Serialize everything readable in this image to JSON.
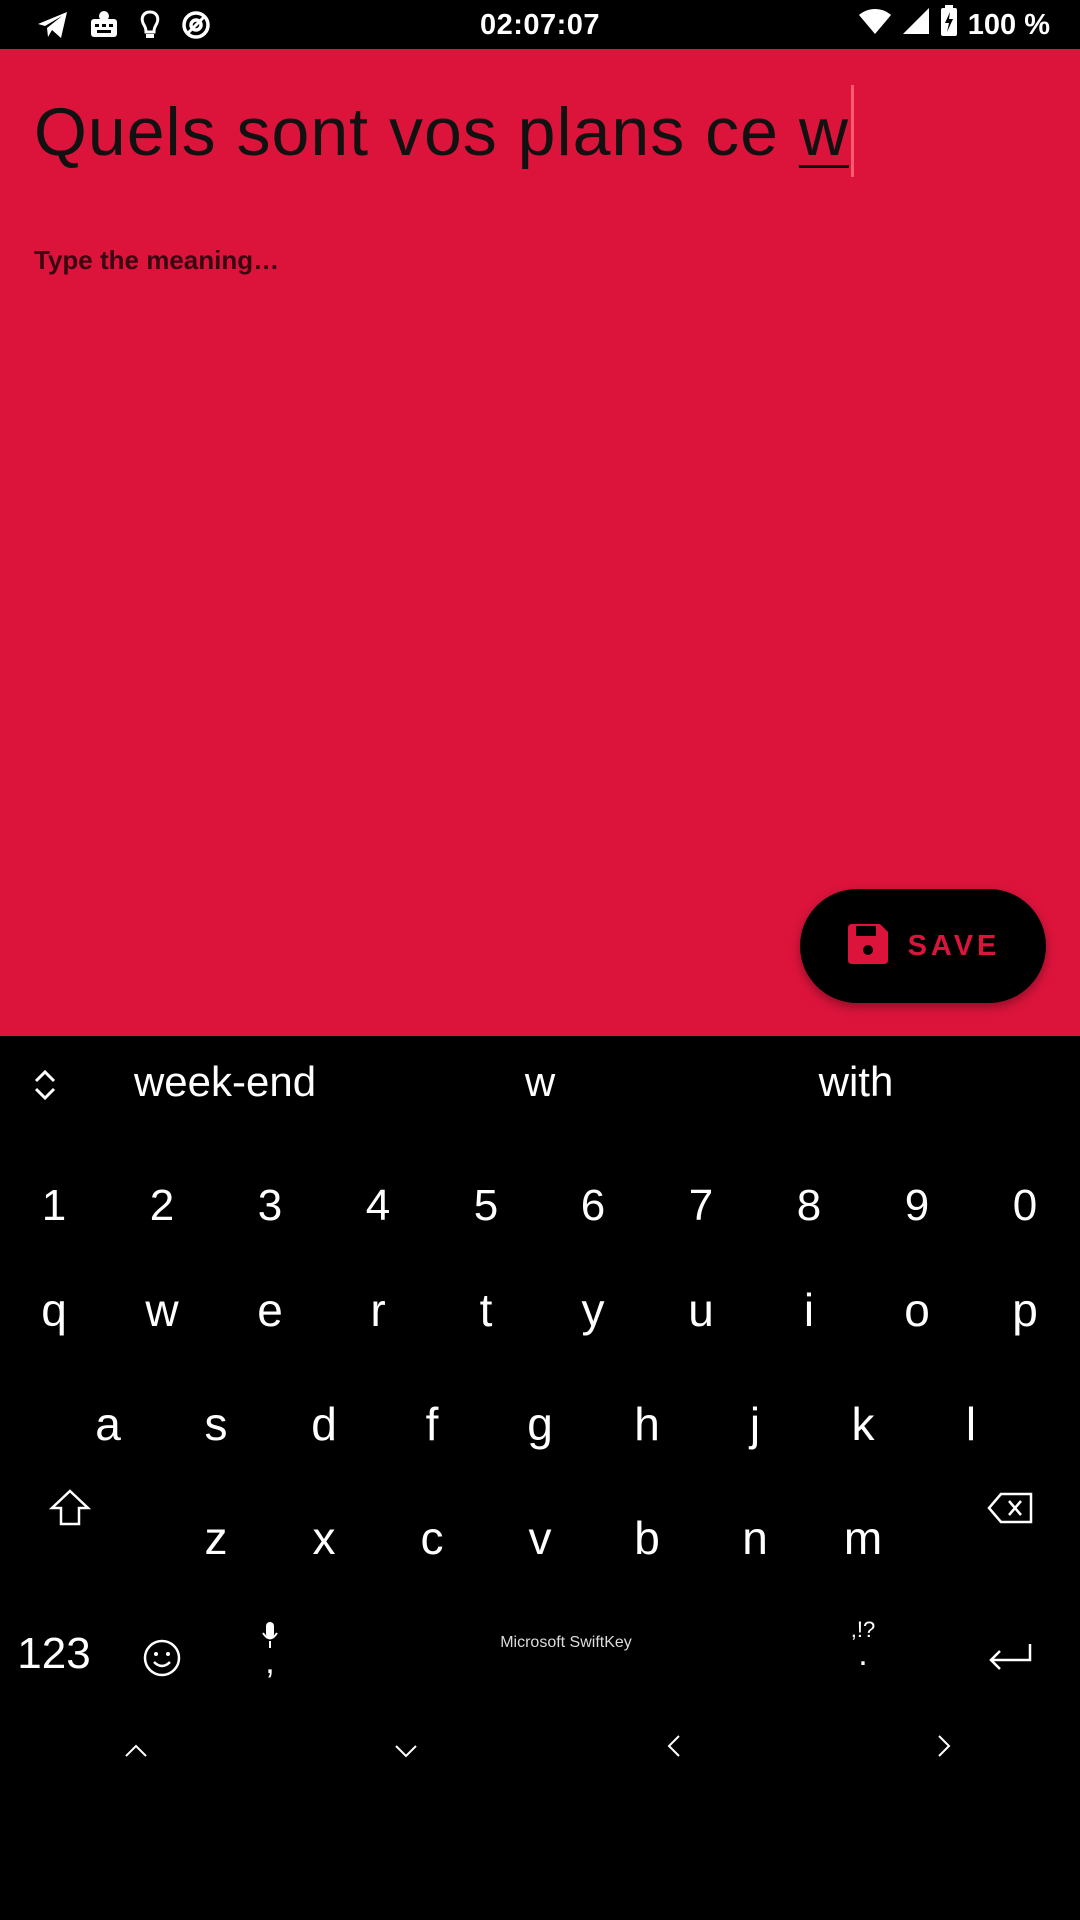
{
  "status_bar": {
    "time": "02:07:07",
    "battery": "100 %",
    "icons_left": [
      "telegram-icon",
      "keyboard-app-icon",
      "bulb-icon",
      "at-sign-icon"
    ],
    "icons_right": [
      "wifi-icon",
      "signal-icon",
      "battery-charging-icon"
    ]
  },
  "editor": {
    "title_text": "Quels sont vos plans ce ",
    "title_composing": "w",
    "meaning_placeholder": "Type the meaning…",
    "accent_color": "#dc143c"
  },
  "save_button": {
    "label": "SAVE",
    "icon": "save-icon"
  },
  "keyboard": {
    "suggestions": [
      "week-end",
      "w",
      "with"
    ],
    "number_row": [
      "1",
      "2",
      "3",
      "4",
      "5",
      "6",
      "7",
      "8",
      "9",
      "0"
    ],
    "row1": [
      "q",
      "w",
      "e",
      "r",
      "t",
      "y",
      "u",
      "i",
      "o",
      "p"
    ],
    "row2": [
      "a",
      "s",
      "d",
      "f",
      "g",
      "h",
      "j",
      "k",
      "l"
    ],
    "row3": [
      "z",
      "x",
      "c",
      "v",
      "b",
      "n",
      "m"
    ],
    "bottom": {
      "mode_label": "123",
      "comma": ",",
      "space_label": "Microsoft SwiftKey",
      "punct_hint": ",!?",
      "period": "."
    }
  }
}
